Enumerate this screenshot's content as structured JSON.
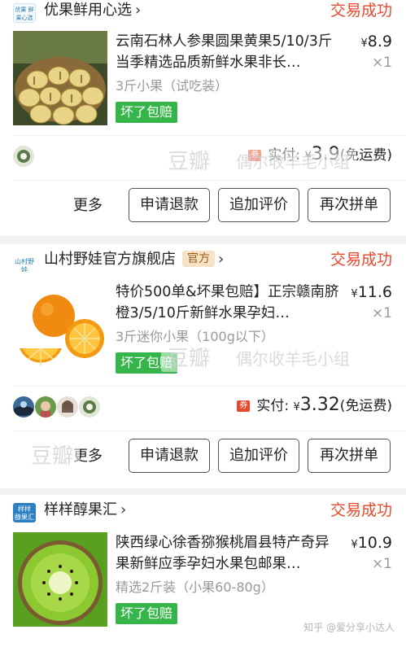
{
  "orders": [
    {
      "shop_logo_text": "优果 鲜果心选",
      "shop_name": "优果鲜用心选",
      "status": "交易成功",
      "title": "云南石林人参果圆果黄果5/10/3斤当季精选品质新鲜水果非长…",
      "price": "8.9",
      "currency": "¥",
      "qty": "×1",
      "spec": "3斤小果（试吃装）",
      "badge": "坏了包赔",
      "paid_icon": "券",
      "paid_label": "实付:",
      "paid_amount": "3.9",
      "shipping": "(免运费)",
      "more": "更多",
      "buttons": [
        "申请退款",
        "追加评价",
        "再次拼单"
      ]
    },
    {
      "shop_logo_text": "山村野娃",
      "shop_name": "山村野娃官方旗舰店",
      "official_tag": "官方",
      "status": "交易成功",
      "title": "特价500单&坏果包赔】正宗赣南脐橙3/5/10斤新鲜水果孕妇…",
      "price": "11.6",
      "currency": "¥",
      "qty": "×1",
      "spec": "3斤迷你小果（100g以下）",
      "badge": "坏了包赔",
      "paid_icon": "券",
      "paid_label": "实付:",
      "paid_amount": "3.32",
      "shipping": "(免运费)",
      "more": "更多",
      "buttons": [
        "申请退款",
        "追加评价",
        "再次拼单"
      ]
    },
    {
      "shop_logo_text": "样样 醇果汇",
      "shop_name": "样样醇果汇",
      "status": "交易成功",
      "title": "陕西绿心徐香猕猴桃眉县特产奇异果新鲜应季孕妇水果包邮果…",
      "price": "10.9",
      "currency": "¥",
      "qty": "×1",
      "spec": "精选2斤装（小果60-80g）",
      "badge": "坏了包赔"
    }
  ],
  "watermarks": {
    "douban": "豆瓣",
    "group": "偶尔收羊毛小组",
    "zhihu": "知乎 @爱分享小达人"
  },
  "colors": {
    "status": "#e6492d",
    "badge": "#35b54a",
    "official_bg": "#f6e2c6"
  }
}
